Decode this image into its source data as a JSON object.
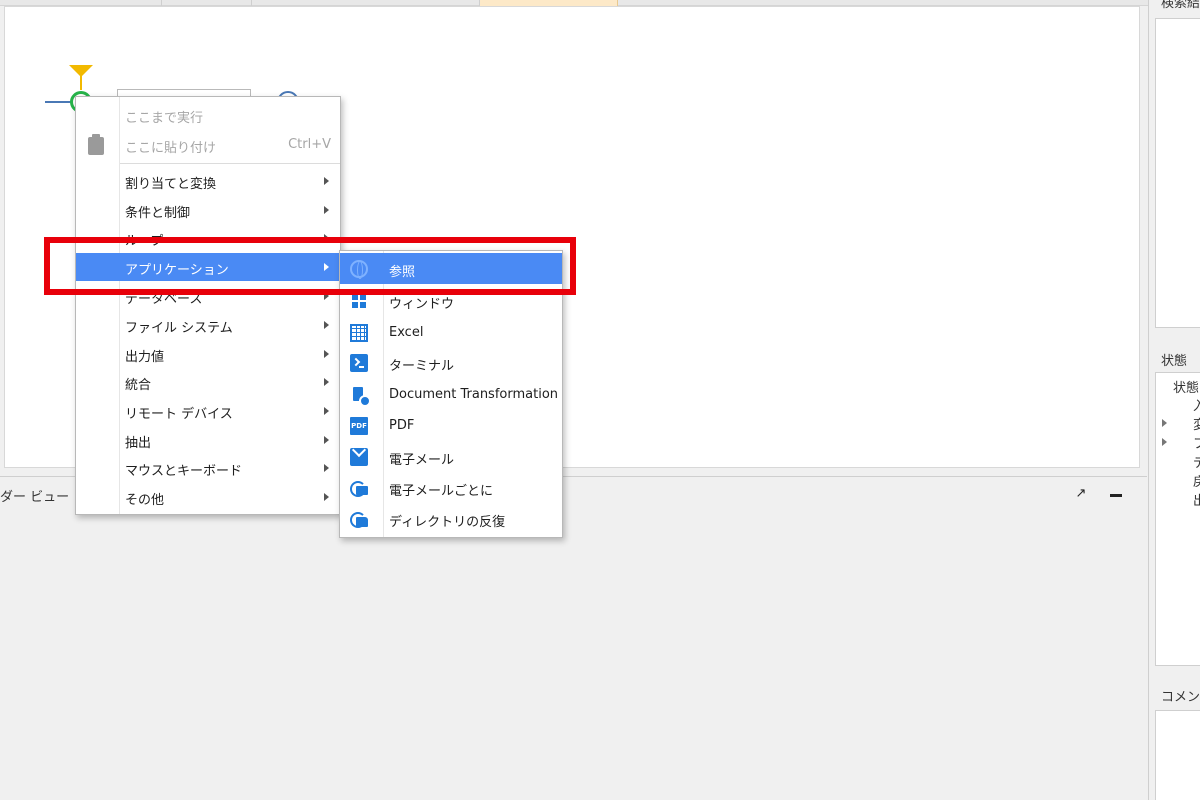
{
  "bottom_panel": {
    "title": "ダー ビュー",
    "pin_icon": "↗"
  },
  "right_panel": {
    "search_title": "検索結",
    "state_title": "状態",
    "state_items": [
      "状態",
      "入",
      "変",
      "フ",
      "デ",
      "戻",
      "出"
    ],
    "comment_title": "コメン"
  },
  "context_menu": {
    "items": [
      {
        "label": "ここまで実行",
        "disabled": true
      },
      {
        "label": "ここに貼り付け",
        "shortcut": "Ctrl+V",
        "disabled": true,
        "icon": "paste-icon"
      },
      {
        "label": "割り当てと変換",
        "submenu": true
      },
      {
        "label": "条件と制御",
        "submenu": true
      },
      {
        "label": "ループ",
        "submenu": true
      },
      {
        "label": "アプリケーション",
        "submenu": true,
        "highlighted": true
      },
      {
        "label": "データベース",
        "submenu": true
      },
      {
        "label": "ファイル システム",
        "submenu": true
      },
      {
        "label": "出力値",
        "submenu": true
      },
      {
        "label": "統合",
        "submenu": true
      },
      {
        "label": "リモート デバイス",
        "submenu": true
      },
      {
        "label": "抽出",
        "submenu": true
      },
      {
        "label": "マウスとキーボード",
        "submenu": true
      },
      {
        "label": "その他",
        "submenu": true
      }
    ]
  },
  "submenu": {
    "items": [
      {
        "label": "参照",
        "icon": "globe-icon",
        "highlighted": true
      },
      {
        "label": "ウィンドウ",
        "icon": "window-icon"
      },
      {
        "label": "Excel",
        "icon": "excel-icon"
      },
      {
        "label": "ターミナル",
        "icon": "terminal-icon"
      },
      {
        "label": "Document Transformation",
        "icon": "document-transformation-icon"
      },
      {
        "label": "PDF",
        "icon": "pdf-icon",
        "icon_text": "PDF"
      },
      {
        "label": "電子メール",
        "icon": "mail-icon"
      },
      {
        "label": "電子メールごとに",
        "icon": "mail-loop-icon"
      },
      {
        "label": "ディレクトリの反復",
        "icon": "directory-loop-icon"
      }
    ]
  },
  "colors": {
    "highlight": "#4a8af4",
    "annotation": "#e8000a",
    "icon_blue": "#1f7ad9",
    "start_node": "#27b34a",
    "marker": "#f2b900"
  }
}
